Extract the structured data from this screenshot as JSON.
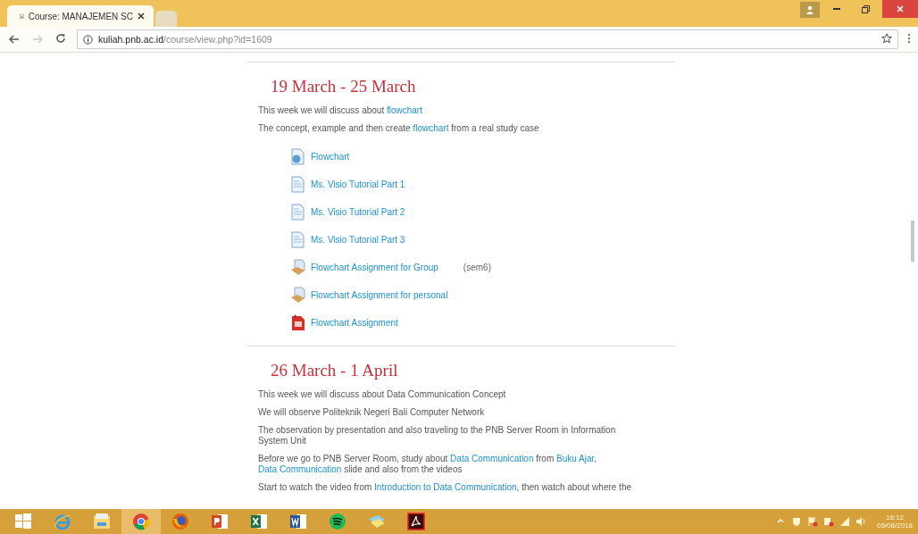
{
  "browser": {
    "tabs": [
      {
        "title": "Course: MANAJEMEN SC",
        "selected": true
      }
    ],
    "address": {
      "domain": "kuliah.pnb.ac.id",
      "path": "/course/view.php?id=1609"
    }
  },
  "sections": [
    {
      "title": "19 March - 25 March",
      "paragraphs": [
        [
          {
            "text": "This week we will discuss about "
          },
          {
            "link": "flowchart"
          }
        ],
        [
          {
            "text": "The concept, example and then create "
          },
          {
            "link": "flowchart"
          },
          {
            "text": " from a real study case"
          }
        ]
      ],
      "activities": [
        {
          "kind": "url",
          "label": "Flowchart"
        },
        {
          "kind": "page",
          "label": "Ms. Visio Tutorial Part 1"
        },
        {
          "kind": "page",
          "label": "Ms. Visio Tutorial Part 2"
        },
        {
          "kind": "page",
          "label": "Ms. Visio Tutorial Part 3"
        },
        {
          "kind": "assign",
          "label": "Flowchart Assignment for Group",
          "note": "(sem6)"
        },
        {
          "kind": "assign",
          "label": "Flowchart Assignment for personal"
        },
        {
          "kind": "pdf",
          "label": "Flowchart Assignment"
        }
      ]
    },
    {
      "title": "26 March - 1 April",
      "paragraphs": [
        [
          {
            "text": "This week we will discuss about Data Communication Concept"
          }
        ],
        [
          {
            "text": "We will observe Politeknik Negeri Bali Computer Network"
          }
        ],
        [
          {
            "text": "The observation by presentation and also traveling to the PNB Server Room in Information System Unit"
          }
        ],
        [
          {
            "text": "Before we go to PNB Server Room, study about "
          },
          {
            "link": "Data Communication"
          },
          {
            "text": " from "
          },
          {
            "link": "Buku Ajar"
          },
          {
            "text": ", "
          },
          {
            "link": "Data Communication"
          },
          {
            "text": " slide and also from the videos"
          }
        ],
        [
          {
            "text": "Start to watch the video from "
          },
          {
            "link": "Introduction to Data Communication"
          },
          {
            "text": ", then watch about where the"
          }
        ]
      ]
    }
  ],
  "taskbar": {
    "apps": [
      {
        "kind": "start",
        "selected": false
      },
      {
        "kind": "ie",
        "selected": false
      },
      {
        "kind": "explorer",
        "selected": false
      },
      {
        "kind": "chrome",
        "selected": true
      },
      {
        "kind": "firefox",
        "selected": false
      },
      {
        "kind": "powerpoint",
        "selected": false
      },
      {
        "kind": "excel",
        "selected": false
      },
      {
        "kind": "word",
        "selected": false
      },
      {
        "kind": "spotify",
        "selected": false
      },
      {
        "kind": "folder",
        "selected": false
      },
      {
        "kind": "acrobat",
        "selected": false
      }
    ],
    "clock": {
      "time": "16:12",
      "date": "05/08/2018"
    }
  }
}
